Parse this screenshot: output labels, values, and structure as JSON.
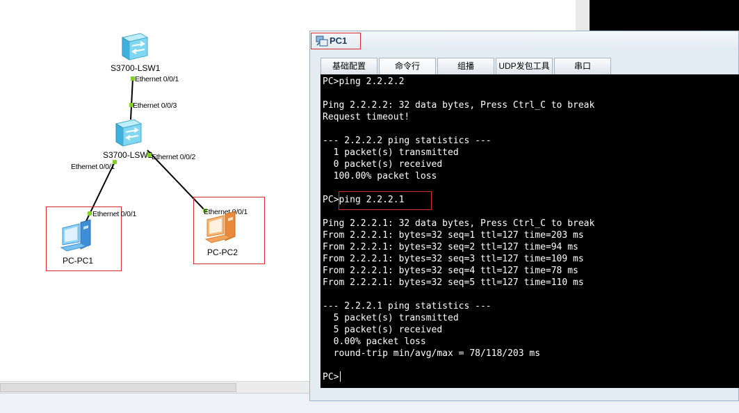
{
  "topology": {
    "devices": {
      "lsw1": "S3700-LSW1",
      "lsw2": "S3700-LSW2",
      "pc1": "PC-PC1",
      "pc2": "PC-PC2"
    },
    "ports": {
      "lsw1_down": "Ethernet 0/0/1",
      "lsw2_up": "Ethernet 0/0/3",
      "lsw2_left": "Ethernet 0/0/1",
      "lsw2_right": "Ethernet 0/0/2",
      "pc1_port": "Ethernet 0/0/1",
      "pc2_port": "Ethernet 0/0/1"
    }
  },
  "window": {
    "title": "PC1",
    "tabs": [
      "基础配置",
      "命令行",
      "组播",
      "UDP发包工具",
      "串口"
    ],
    "active_tab": 1
  },
  "terminal": {
    "lines": [
      "PC>ping 2.2.2.2",
      "",
      "Ping 2.2.2.2: 32 data bytes, Press Ctrl_C to break",
      "Request timeout!",
      "",
      "--- 2.2.2.2 ping statistics ---",
      "  1 packet(s) transmitted",
      "  0 packet(s) received",
      "  100.00% packet loss",
      "",
      "PC>ping 2.2.2.1",
      "",
      "Ping 2.2.2.1: 32 data bytes, Press Ctrl_C to break",
      "From 2.2.2.1: bytes=32 seq=1 ttl=127 time=203 ms",
      "From 2.2.2.1: bytes=32 seq=2 ttl=127 time=94 ms",
      "From 2.2.2.1: bytes=32 seq=3 ttl=127 time=109 ms",
      "From 2.2.2.1: bytes=32 seq=4 ttl=127 time=78 ms",
      "From 2.2.2.1: bytes=32 seq=5 ttl=127 time=110 ms",
      "",
      "--- 2.2.2.1 ping statistics ---",
      "  5 packet(s) transmitted",
      "  5 packet(s) received",
      "  0.00% packet loss",
      "  round-trip min/avg/max = 78/118/203 ms",
      "",
      "PC>"
    ]
  },
  "colors": {
    "highlight": "#d62a2a",
    "link": "#000000",
    "port_dot": "#7ed321",
    "switch": "#6fd0ef",
    "pc1": "#5fb4ec",
    "pc2": "#f0a35a"
  }
}
